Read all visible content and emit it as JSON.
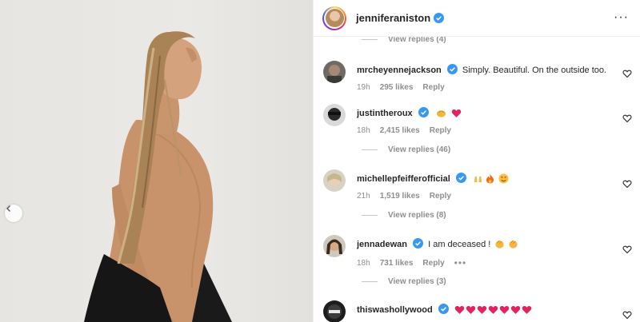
{
  "header": {
    "username": "jenniferaniston",
    "more_label": "···"
  },
  "comments": {
    "top_view_replies": "View replies (4)",
    "items": [
      {
        "username": "mrcheyennejackson",
        "text": "Simply. Beautiful. On the outside too.",
        "time": "19h",
        "likes": "295 likes",
        "reply": "Reply",
        "view_replies": ""
      },
      {
        "username": "justintheroux",
        "text": "",
        "emojis": [
          "punch",
          "red-heart"
        ],
        "time": "18h",
        "likes": "2,415 likes",
        "reply": "Reply",
        "view_replies": "View replies (46)"
      },
      {
        "username": "michellepfeifferofficial",
        "text": "",
        "emojis": [
          "raising-hands",
          "fire",
          "heart-eyes"
        ],
        "time": "21h",
        "likes": "1,519 likes",
        "reply": "Reply",
        "view_replies": "View replies (8)"
      },
      {
        "username": "jennadewan",
        "text": "I am deceased !",
        "emojis": [
          "clap",
          "clap"
        ],
        "time": "18h",
        "likes": "731 likes",
        "reply": "Reply",
        "more": "•••",
        "view_replies": "View replies (3)"
      },
      {
        "username": "thiswashollywood",
        "text": "",
        "emojis": [
          "red-heart",
          "red-heart",
          "red-heart",
          "red-heart",
          "red-heart",
          "red-heart",
          "red-heart"
        ]
      }
    ]
  },
  "colors": {
    "verified": "#3897f0",
    "heart_emoji": "#e0245e",
    "muted_text": "#8e8e8e",
    "divider": "#efefef"
  },
  "icons": [
    "verified-badge-icon",
    "heart-outline-icon",
    "chevron-left-icon",
    "more-options-icon"
  ]
}
